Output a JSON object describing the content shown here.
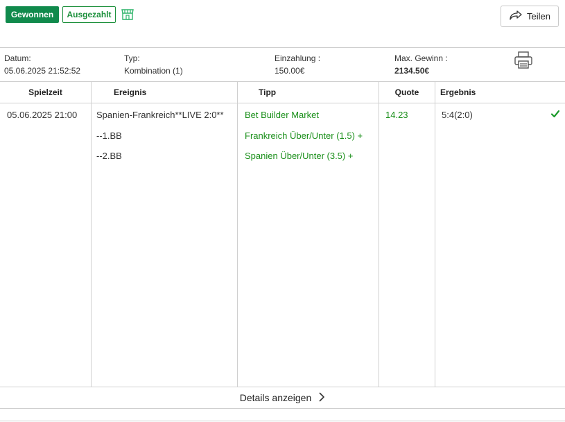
{
  "badges": {
    "won": "Gewonnen",
    "paid": "Ausgezahlt"
  },
  "share": {
    "label": "Teilen"
  },
  "meta": {
    "date_label": "Datum:",
    "date_value": "05.06.2025 21:52:52",
    "type_label": "Typ:",
    "type_value": "Kombination (1)",
    "stake_label": "Einzahlung :",
    "stake_value": "150.00€",
    "maxwin_label": "Max. Gewinn :",
    "maxwin_value": "2134.50€"
  },
  "table": {
    "headers": [
      "Spielzeit",
      "Ereignis",
      "Tipp",
      "Quote",
      "Ergebnis"
    ],
    "row": {
      "time": "05.06.2025 21:00",
      "event": [
        "Spanien-Frankreich**LIVE 2:0**",
        "--1.BB",
        "--2.BB"
      ],
      "tips": [
        "Bet Builder Market",
        "Frankreich Über/Unter (1.5) +",
        "Spanien Über/Unter (3.5) +"
      ],
      "odds": "14.23",
      "result": "5:4(2:0)"
    }
  },
  "details": {
    "label": "Details anzeigen"
  },
  "colors": {
    "accent_green": "#108a4c",
    "text_green": "#1a8f1a",
    "border": "#cfcfcf"
  }
}
